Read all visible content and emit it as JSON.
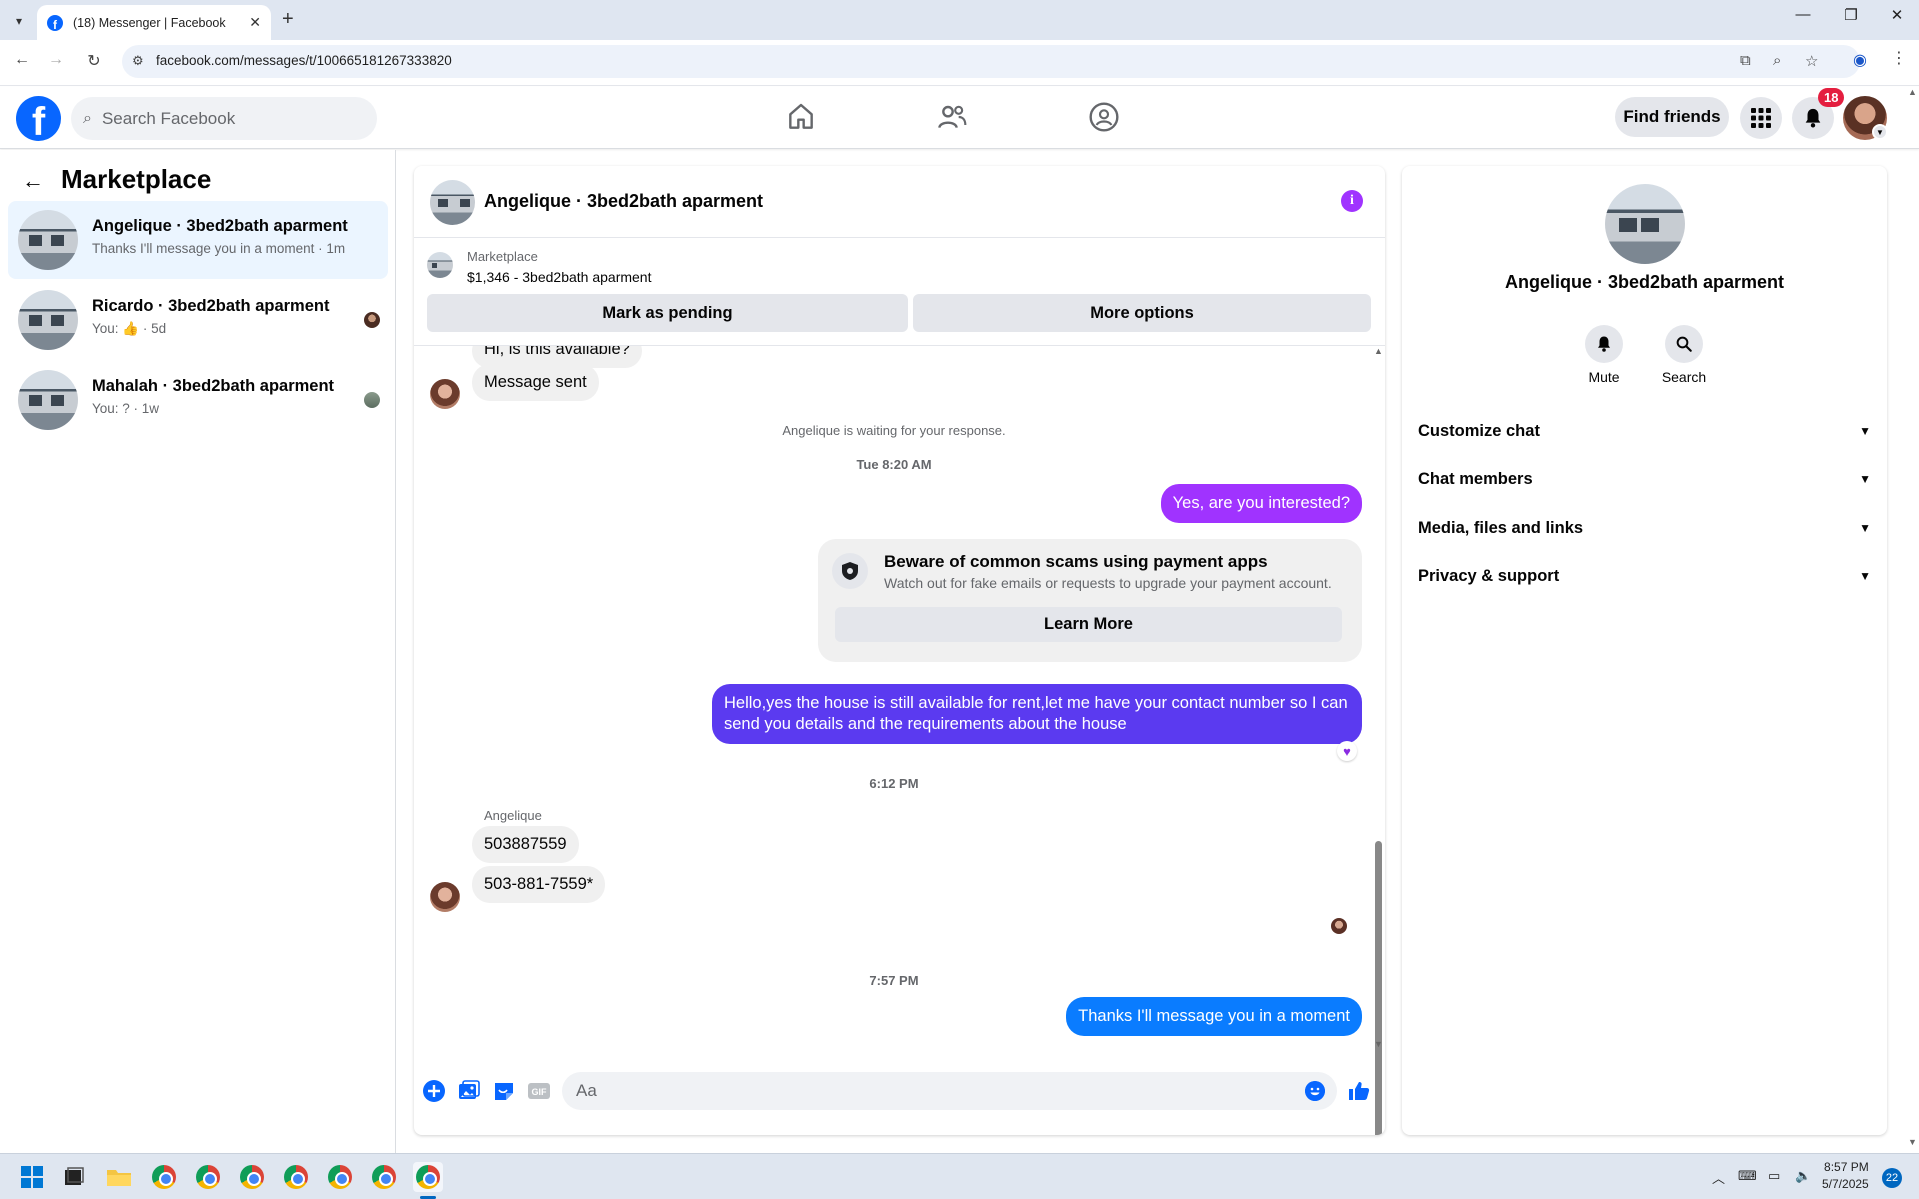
{
  "browser": {
    "tab_title": "(18) Messenger | Facebook",
    "url": "facebook.com/messages/t/100665181267333820"
  },
  "fb_header": {
    "search_placeholder": "Search Facebook",
    "find_friends": "Find friends",
    "notification_count": "18"
  },
  "sidebar": {
    "title": "Marketplace",
    "conversations": [
      {
        "name": "Angelique · 3bed2bath aparment",
        "snippet": "Thanks I'll message you in a moment · 1m",
        "active": true
      },
      {
        "name": "Ricardo · 3bed2bath aparment",
        "snippet_prefix": "You:",
        "snippet_suffix": "· 5d"
      },
      {
        "name": "Mahalah · 3bed2bath aparment",
        "snippet": "You: ? · 1w"
      }
    ]
  },
  "chat": {
    "title": "Angelique · 3bed2bath aparment",
    "marketplace_label": "Marketplace",
    "listing": "$1,346 - 3bed2bath aparment",
    "mark_pending": "Mark as pending",
    "more_options": "More options",
    "messages": {
      "partial_top": "Hi, is this available?",
      "msg_sent": "Message sent",
      "waiting": "Angelique is waiting for your response.",
      "stamp1": "Tue 8:20 AM",
      "out1": "Yes, are you interested?",
      "scam_title": "Beware of common scams using payment apps",
      "scam_sub": "Watch out for fake emails or requests to upgrade your payment account.",
      "learn_more": "Learn More",
      "out2": "Hello,yes the house is still available for rent,let me have your contact number   so I can send you details and the requirements about the house",
      "stamp2": "6:12 PM",
      "sender": "Angelique",
      "in1": "503887559",
      "in2": "503-881-7559*",
      "stamp3": "7:57 PM",
      "out3": "Thanks I'll message you in a moment"
    },
    "composer_placeholder": "Aa"
  },
  "right_panel": {
    "name": "Angelique · 3bed2bath aparment",
    "mute": "Mute",
    "search": "Search",
    "sections": [
      "Customize chat",
      "Chat members",
      "Media, files and links",
      "Privacy & support"
    ]
  },
  "taskbar": {
    "time": "8:57 PM",
    "date": "5/7/2025",
    "badge": "22"
  },
  "colors": {
    "fb_blue": "#0866ff",
    "bubble_purple": "#a033ff",
    "bubble_indigo": "#5b3af0",
    "bubble_blue": "#0a7cff"
  }
}
